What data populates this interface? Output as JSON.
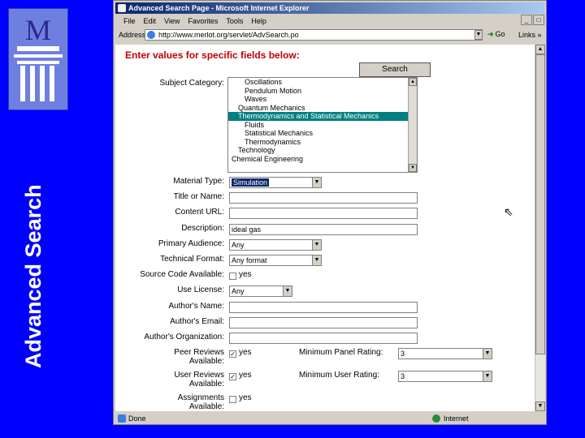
{
  "sidebar": {
    "title": "Advanced Search",
    "logo_letter": "M"
  },
  "window": {
    "title": "Advanced Search Page - Microsoft Internet Explorer",
    "menu": [
      "File",
      "Edit",
      "View",
      "Favorites",
      "Tools",
      "Help"
    ],
    "address_label": "Address",
    "address_value": "http://www.merlot.org/servlet/AdvSearch.po",
    "go_label": "Go",
    "links_label": "Links »",
    "status_text": "Done",
    "zone_text": "Internet"
  },
  "form": {
    "heading": "Enter values for specific fields below:",
    "search_button": "Search",
    "subject_label": "Subject Category:",
    "subjects": [
      {
        "text": "Oscillations",
        "indent": 2
      },
      {
        "text": "Pendulum Motion",
        "indent": 2
      },
      {
        "text": "Waves",
        "indent": 2
      },
      {
        "text": "Quantum Mechanics",
        "indent": 1
      },
      {
        "text": "Thermodynamics and Statistical Mechanics",
        "indent": 1,
        "selected": true
      },
      {
        "text": "Fluids",
        "indent": 2
      },
      {
        "text": "Statistical Mechanics",
        "indent": 2
      },
      {
        "text": "Thermodynamics",
        "indent": 2
      },
      {
        "text": "Technology",
        "indent": 1
      },
      {
        "text": "Chemical Engineering",
        "indent": 0
      }
    ],
    "fields": [
      {
        "label": "Material Type:",
        "kind": "select",
        "value": "Simulation",
        "width": 114,
        "focus": true
      },
      {
        "label": "Title or Name:",
        "kind": "text",
        "value": ""
      },
      {
        "label": "Content URL:",
        "kind": "text",
        "value": ""
      },
      {
        "label": "Description:",
        "kind": "text",
        "value": "ideal gas"
      },
      {
        "label": "Primary Audience:",
        "kind": "select",
        "value": "Any",
        "width": 114
      },
      {
        "label": "Technical Format:",
        "kind": "select",
        "value": "Any format",
        "width": 114
      },
      {
        "label": "Source Code Available:",
        "kind": "checkbox",
        "value": "yes",
        "checked": false
      },
      {
        "label": "Use License:",
        "kind": "select",
        "value": "Any",
        "width": 78
      },
      {
        "label": "Author's Name:",
        "kind": "text",
        "value": ""
      },
      {
        "label": "Author's Email:",
        "kind": "text",
        "value": ""
      },
      {
        "label": "Author's Organization:",
        "kind": "text",
        "value": ""
      }
    ],
    "reviews": [
      {
        "label1": "Peer Reviews",
        "label2": "Available:",
        "cb": "yes",
        "checked": true,
        "rating_label": "Minimum Panel Rating:",
        "rating": "3"
      },
      {
        "label1": "User Reviews",
        "label2": "Available:",
        "cb": "yes",
        "checked": true,
        "rating_label": "Minimum User Rating:",
        "rating": "3"
      },
      {
        "label1": "Assignments",
        "label2": "Available:",
        "cb": "yes",
        "checked": false
      }
    ]
  }
}
